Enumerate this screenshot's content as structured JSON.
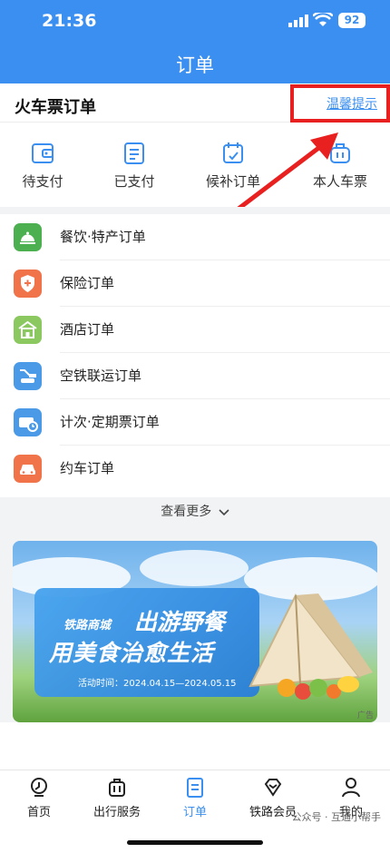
{
  "status_bar": {
    "time": "21:36",
    "battery": "92"
  },
  "header": {
    "title": "订单"
  },
  "train_orders": {
    "title": "火车票订单",
    "tips_link": "温馨提示",
    "statuses": [
      {
        "label": "待支付",
        "icon": "wallet-icon"
      },
      {
        "label": "已支付",
        "icon": "receipt-icon"
      },
      {
        "label": "候补订单",
        "icon": "calendar-icon"
      },
      {
        "label": "本人车票",
        "icon": "luggage-icon"
      }
    ]
  },
  "other_orders": [
    {
      "label": "餐饮·特产订单",
      "icon": "food-icon",
      "color": "#4caf50"
    },
    {
      "label": "保险订单",
      "icon": "shield-icon",
      "color": "#f0734a"
    },
    {
      "label": "酒店订单",
      "icon": "hotel-icon",
      "color": "#8bc860"
    },
    {
      "label": "空铁联运订单",
      "icon": "plane-train-icon",
      "color": "#4a9ae8"
    },
    {
      "label": "计次·定期票订单",
      "icon": "ticket-icon",
      "color": "#4a9ae8"
    },
    {
      "label": "约车订单",
      "icon": "car-icon",
      "color": "#f0734a"
    }
  ],
  "more_label": "查看更多",
  "banner": {
    "brand": "铁路商城",
    "title1": "出游野餐",
    "title2": "用美食治愈生活",
    "date": "活动时间：2024.04.15—2024.05.15",
    "ad_tag": "广告"
  },
  "tabbar": [
    {
      "label": "首页",
      "icon": "home-icon",
      "active": false
    },
    {
      "label": "出行服务",
      "icon": "travel-icon",
      "active": false
    },
    {
      "label": "订单",
      "icon": "order-icon",
      "active": true
    },
    {
      "label": "铁路会员",
      "icon": "member-icon",
      "active": false
    },
    {
      "label": "我的",
      "icon": "profile-icon",
      "active": false
    }
  ],
  "watermark": "公众号 · 互通小帮手",
  "colors": {
    "primary": "#3b8ff0",
    "highlight": "#e8201f"
  }
}
